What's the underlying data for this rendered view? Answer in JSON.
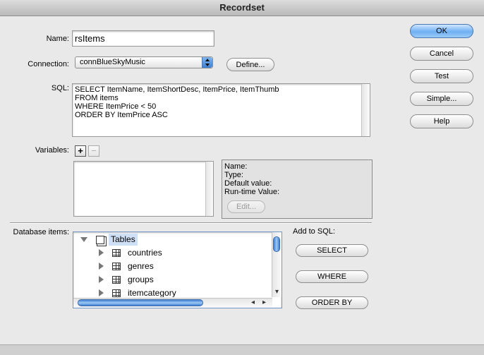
{
  "window": {
    "title": "Recordset"
  },
  "form": {
    "name_label": "Name:",
    "name_value": "rsItems",
    "connection_label": "Connection:",
    "connection_value": "connBlueSkyMusic",
    "define_label": "Define...",
    "sql_label": "SQL:",
    "sql_lines": [
      "SELECT ItemName, ItemShortDesc, ItemPrice, ItemThumb",
      "FROM items",
      "WHERE ItemPrice < 50",
      "ORDER BY ItemPrice ASC"
    ],
    "variables_label": "Variables:",
    "add_glyph": "+",
    "remove_glyph": "−"
  },
  "variable_details": {
    "name_label": "Name:",
    "type_label": "Type:",
    "default_label": "Default value:",
    "runtime_label": "Run-time Value:",
    "edit_label": "Edit..."
  },
  "database": {
    "label": "Database items:",
    "root": "Tables",
    "tables": [
      "countries",
      "genres",
      "groups",
      "itemcategory"
    ],
    "scroll_left": "◂",
    "scroll_right": "▸",
    "scroll_down": "▾"
  },
  "add_to_sql": {
    "label": "Add to SQL:",
    "select": "SELECT",
    "where": "WHERE",
    "order_by": "ORDER BY"
  },
  "side_buttons": {
    "ok": "OK",
    "cancel": "Cancel",
    "test": "Test",
    "simple": "Simple...",
    "help": "Help"
  }
}
